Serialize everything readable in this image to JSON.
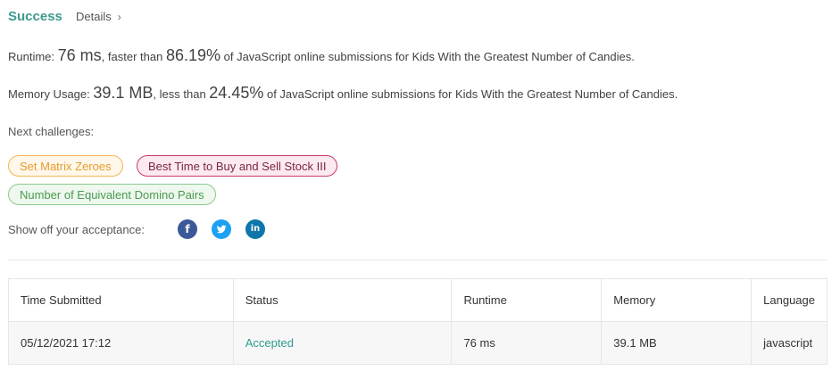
{
  "header": {
    "status": "Success",
    "details": "Details",
    "details_chevron": "›"
  },
  "runtime_line": {
    "prefix": "Runtime: ",
    "value": "76 ms",
    "middle": ", faster than ",
    "percent": "86.19%",
    "suffix": " of JavaScript online submissions for Kids With the Greatest Number of Candies."
  },
  "memory_line": {
    "prefix": "Memory Usage: ",
    "value": "39.1 MB",
    "middle": ", less than ",
    "percent": "24.45%",
    "suffix": " of JavaScript online submissions for Kids With the Greatest Number of Candies."
  },
  "next_challenges": {
    "label": "Next challenges:",
    "items": [
      "Set Matrix Zeroes",
      "Best Time to Buy and Sell Stock III",
      "Number of Equivalent Domino Pairs"
    ]
  },
  "share": {
    "label": "Show off your acceptance:",
    "icons": [
      "facebook-icon",
      "twitter-icon",
      "linkedin-icon"
    ]
  },
  "table": {
    "headers": [
      "Time Submitted",
      "Status",
      "Runtime",
      "Memory",
      "Language"
    ],
    "rows": [
      [
        "05/12/2021 17:12",
        "Accepted",
        "76 ms",
        "39.1 MB",
        "javascript"
      ]
    ]
  },
  "colors": {
    "success": "#3e9a8d",
    "accepted": "#2e9b8e",
    "facebook": "#3b5998",
    "twitter": "#1da1f2",
    "linkedin": "#0e76a8"
  }
}
